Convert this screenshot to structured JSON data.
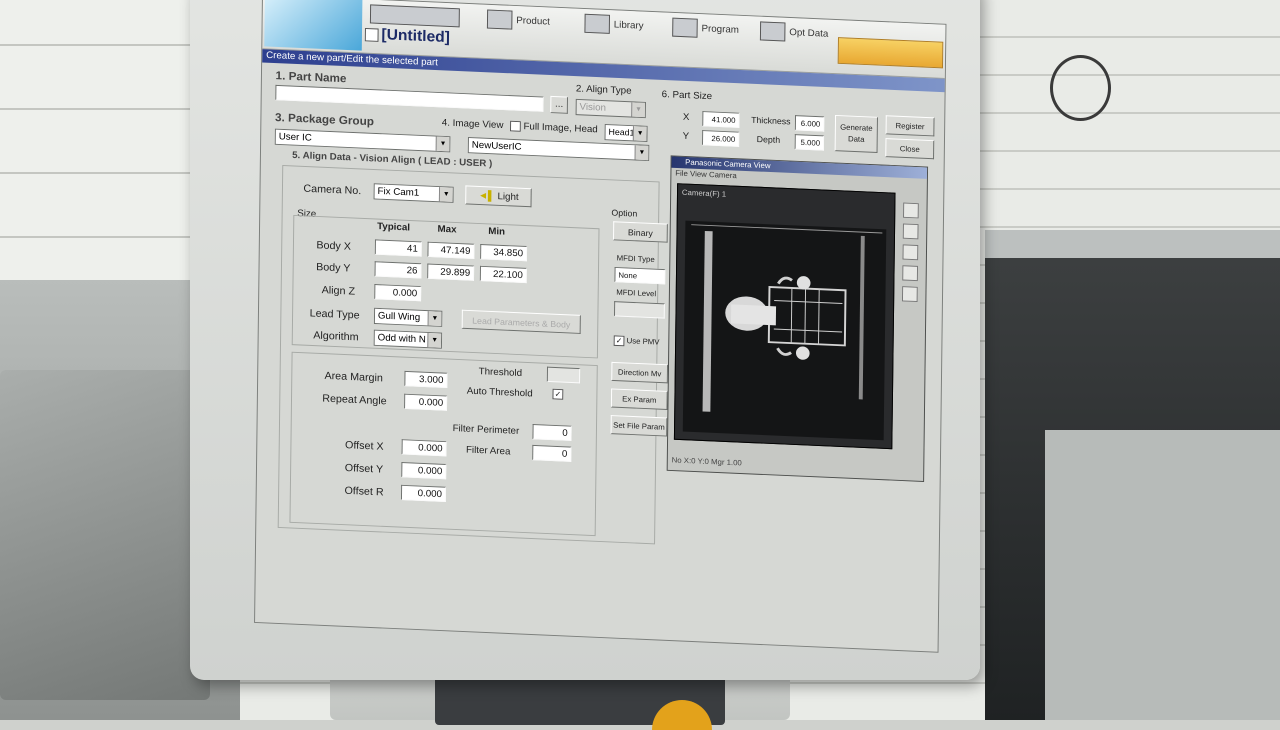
{
  "toolbar": {
    "tab_top": "",
    "product_label": "Product",
    "library_label": "Library",
    "program_label": "Program",
    "optdata_label": "Opt Data",
    "file_title": "[Untitled]",
    "hint": "Create a new part/Edit the selected part"
  },
  "part_name": {
    "label": "1. Part Name",
    "value": "",
    "browse": "..."
  },
  "align_type": {
    "label": "2. Align Type",
    "value": "Vision"
  },
  "package_group": {
    "label": "3. Package Group",
    "value": "User IC"
  },
  "image_view": {
    "label": "4. Image View",
    "full_image_label": "Full Image",
    "head_label": "Head",
    "head_value": "Head1",
    "value": "NewUserIC"
  },
  "part_size": {
    "label": "6. Part Size",
    "x_label": "X",
    "x_value": "41.000",
    "y_label": "Y",
    "y_value": "26.000",
    "thickness_label": "Thickness",
    "thickness_value": "6.000",
    "depth_label": "Depth",
    "depth_value": "5.000",
    "generate_label": "Generate Data",
    "register_label": "Register",
    "close_label": "Close"
  },
  "align_data": {
    "title": "5. Align Data - Vision Align ( LEAD : USER )",
    "camera_label": "Camera No.",
    "camera_value": "Fix Cam1",
    "light_label": "Light",
    "size_label": "Size",
    "col_typical": "Typical",
    "col_max": "Max",
    "col_min": "Min",
    "body_x_label": "Body X",
    "body_x_typical": "41",
    "body_x_max": "47.149",
    "body_x_min": "34.850",
    "body_y_label": "Body Y",
    "body_y_typical": "26",
    "body_y_max": "29.899",
    "body_y_min": "22.100",
    "align_z_label": "Align Z",
    "align_z_value": "0.000",
    "lead_type_label": "Lead Type",
    "lead_type_value": "Gull Wing",
    "algorithm_label": "Algorithm",
    "algorithm_value": "Odd with N",
    "lead_param_label": "Lead Parameters & Body",
    "area_margin_label": "Area Margin",
    "area_margin_value": "3.000",
    "repeat_angle_label": "Repeat Angle",
    "repeat_angle_value": "0.000",
    "threshold_label": "Threshold",
    "threshold_value": "",
    "auto_threshold_label": "Auto Threshold",
    "filter_perimeter_label": "Filter Perimeter",
    "filter_perimeter_value": "0",
    "filter_area_label": "Filter Area",
    "filter_area_value": "0",
    "offset_x_label": "Offset X",
    "offset_x_value": "0.000",
    "offset_y_label": "Offset Y",
    "offset_y_value": "0.000",
    "offset_r_label": "Offset R",
    "offset_r_value": "0.000"
  },
  "option": {
    "label": "Option",
    "binary_btn": "Binary",
    "mf_type_label": "MFDI Type",
    "mf_type_value": "None",
    "mf_level_label": "MFDI Level",
    "use_pmv_label": "Use PMV",
    "direction_btn": "Direction Mv",
    "ex_param_btn": "Ex Param",
    "set_file_btn": "Set File Param"
  },
  "camera_window": {
    "title": "Panasonic Camera View",
    "menu": "File  View  Camera",
    "view_label": "Camera(F) 1",
    "status": "No   X:0  Y:0  Mgr 1.00"
  }
}
